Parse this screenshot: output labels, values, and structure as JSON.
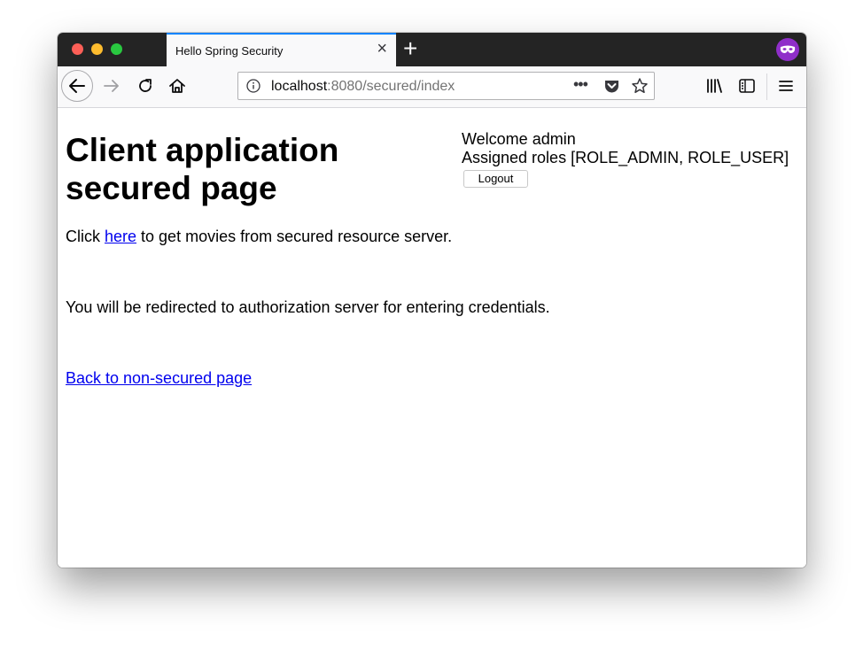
{
  "browser": {
    "tab": {
      "title": "Hello Spring Security",
      "close_symbol": "×"
    },
    "new_tab_symbol": "+",
    "url": {
      "host": "localhost",
      "rest": ":8080/secured/index"
    },
    "url_more_symbol": "•••",
    "accent_color": "#0a84ff",
    "private_color": "#8f2ec9",
    "icons": [
      "back-icon",
      "forward-icon",
      "reload-icon",
      "home-icon",
      "info-icon",
      "pocket-icon",
      "bookmark-star-icon",
      "library-icon",
      "sidebar-icon",
      "menu-icon",
      "private-browsing-icon"
    ]
  },
  "page": {
    "title": "Client application secured page",
    "user": {
      "welcome": "Welcome admin",
      "roles": "Assigned roles [ROLE_ADMIN, ROLE_USER]",
      "logout_label": "Logout"
    },
    "click_prefix": "Click ",
    "click_link": "here",
    "click_suffix": " to get movies from secured resource server.",
    "redirect_note": "You will be redirected to authorization server for entering credentials.",
    "back_link": "Back to non-secured page",
    "link_color": "#0000ee"
  }
}
